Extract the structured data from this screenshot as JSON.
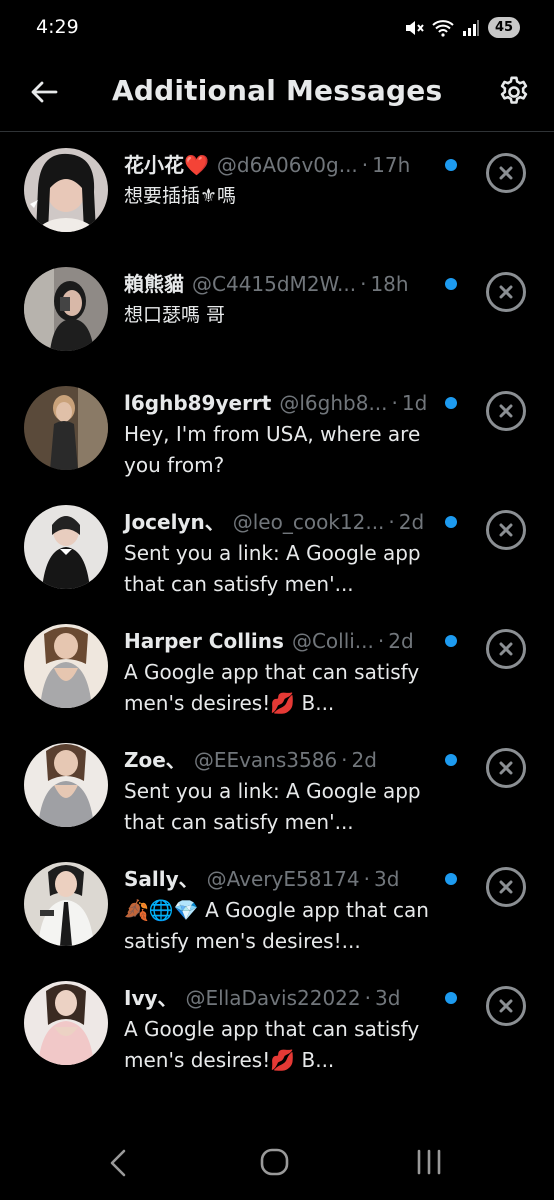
{
  "status_bar": {
    "time": "4:29",
    "battery": "45",
    "icons": [
      "mute-icon",
      "wifi-icon",
      "signal-icon",
      "battery-icon"
    ]
  },
  "header": {
    "title": "Additional Messages",
    "back_icon": "back-arrow-icon",
    "settings_icon": "gear-icon"
  },
  "colors": {
    "background": "#000000",
    "text_primary": "#e7e9ea",
    "text_secondary": "#71767b",
    "unread_dot": "#1d9bf0",
    "divider": "#2f3336"
  },
  "messages": [
    {
      "name": "花小花❤️",
      "handle": "@d6A06v0g...",
      "time": "17h",
      "text": "想要插插⚜嗎",
      "unread": true
    },
    {
      "name": "賴熊貓",
      "handle": "@C4415dM2W...",
      "time": "18h",
      "text": "想口瑟嗎 哥",
      "unread": true
    },
    {
      "name": "l6ghb89yerrt",
      "handle": "@l6ghb8...",
      "time": "1d",
      "text": "Hey, I'm from USA, where are you from?",
      "unread": true
    },
    {
      "name": "Jocelyn、",
      "handle": "@leo_cook12...",
      "time": "2d",
      "text": "Sent you a link: A Google app that can satisfy men'...",
      "unread": true
    },
    {
      "name": "Harper Collins",
      "handle": "@Colli...",
      "time": "2d",
      "text": "A Google app that can satisfy men's desires!💋 B...",
      "unread": true
    },
    {
      "name": "Zoe、",
      "handle": "@EEvans3586",
      "time": "2d",
      "text": "Sent you a link: A Google app that can satisfy men'...",
      "unread": true
    },
    {
      "name": "Sally、",
      "handle": "@AveryE58174",
      "time": "3d",
      "text": "🍂🌐💎 A Google app that can satisfy men's desires!...",
      "unread": true
    },
    {
      "name": "Ivy、",
      "handle": "@EllaDavis22022",
      "time": "3d",
      "text": "A Google app that can satisfy men's desires!💋 B...",
      "unread": true
    }
  ],
  "nav_bar": {
    "icons": [
      "nav-back-icon",
      "nav-home-icon",
      "nav-recent-apps-icon"
    ]
  }
}
